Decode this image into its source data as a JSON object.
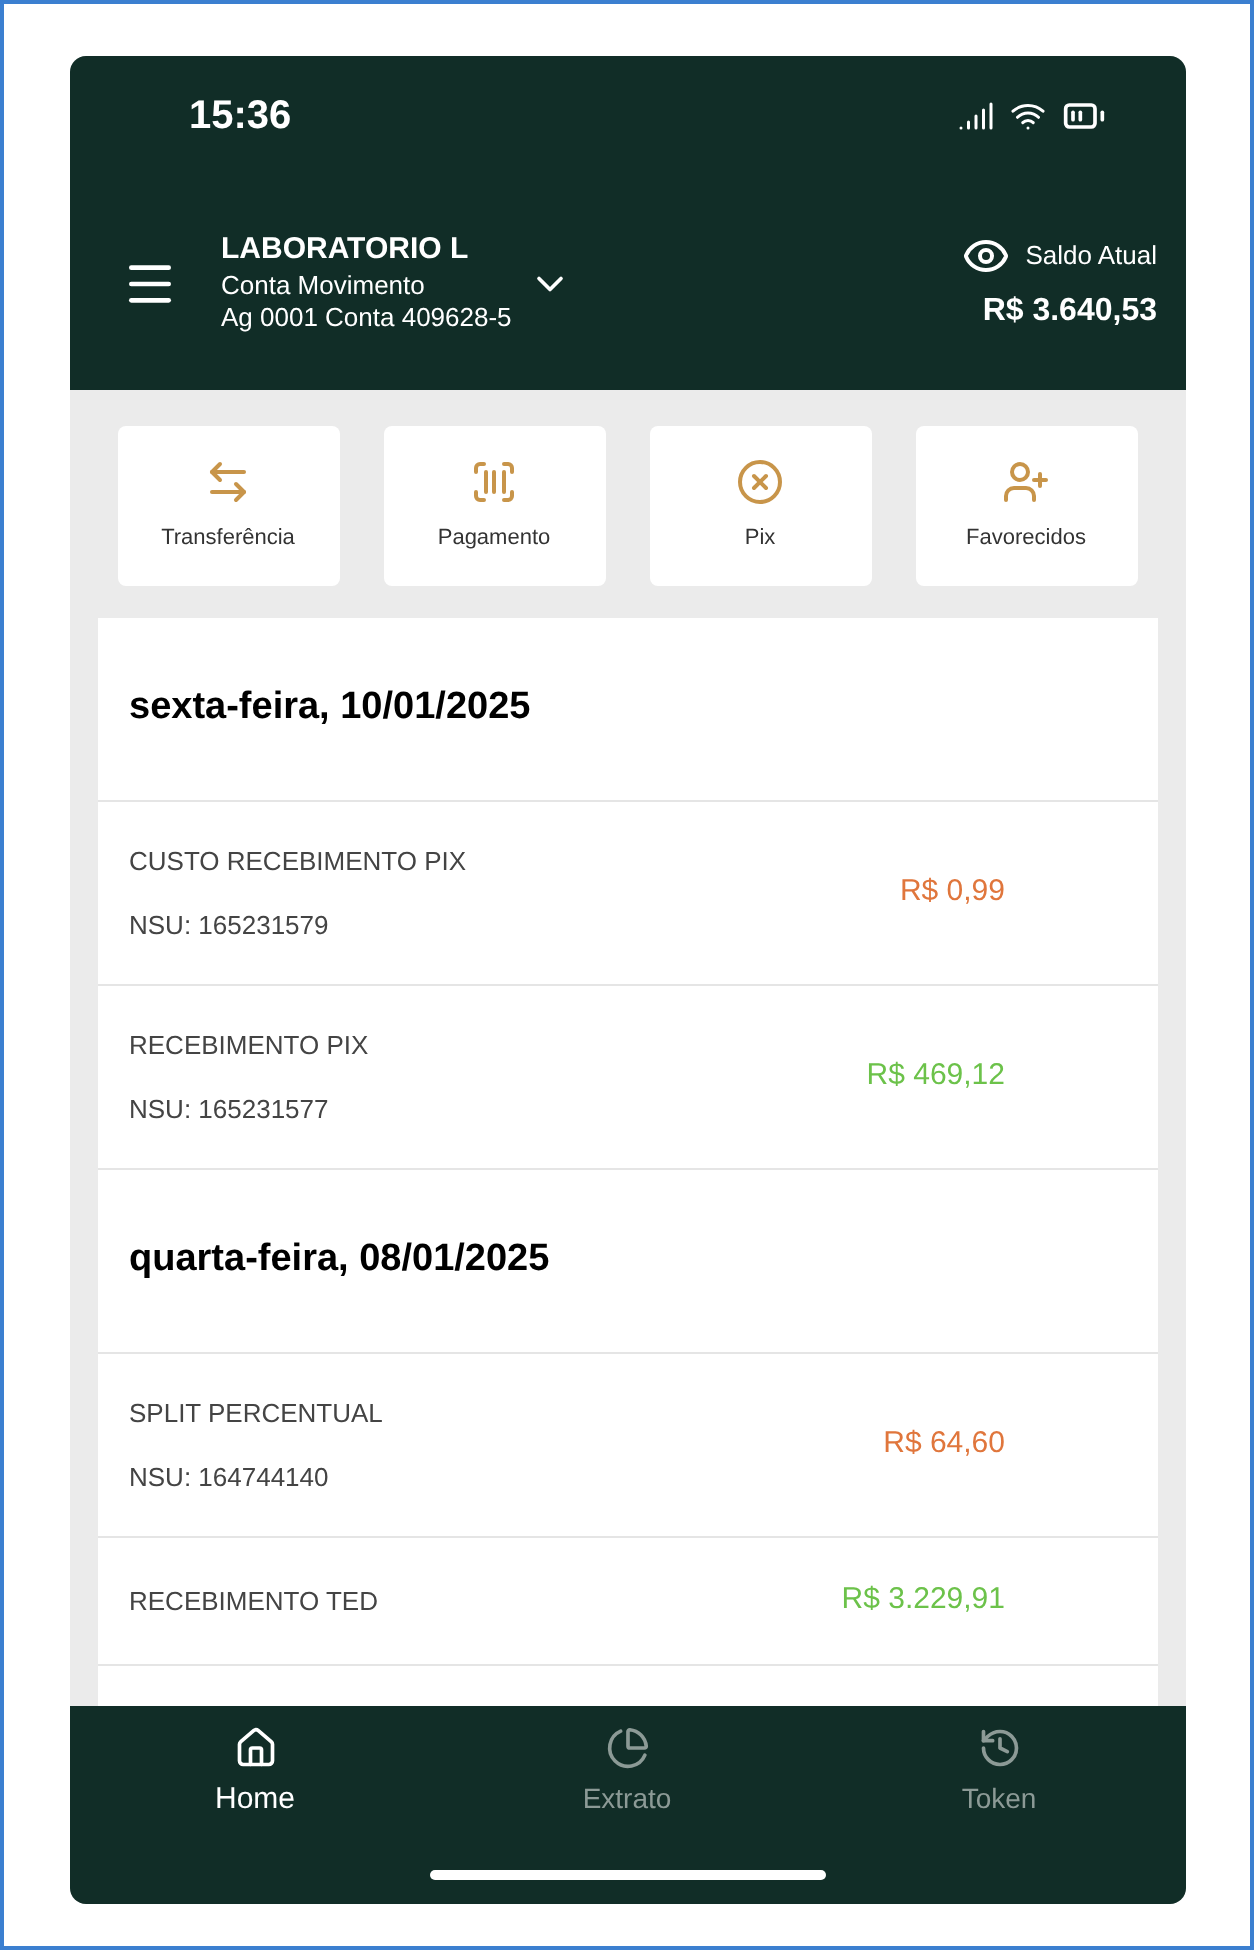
{
  "status_bar": {
    "time": "15:36"
  },
  "account": {
    "name": "LABORATORIO L",
    "type": "Conta Movimento",
    "number": "Ag 0001 Conta 409628-5",
    "balance_label": "Saldo Atual",
    "balance": "R$ 3.640,53"
  },
  "shortcuts": [
    {
      "kind": "transfer",
      "label": "Transferência"
    },
    {
      "kind": "payment",
      "label": "Pagamento"
    },
    {
      "kind": "pix",
      "label": "Pix"
    },
    {
      "kind": "payees",
      "label": "Favorecidos"
    }
  ],
  "days": [
    {
      "date": "sexta-feira, 10/01/2025",
      "transactions": [
        {
          "title": "CUSTO RECEBIMENTO PIX",
          "nsu": "NSU: 165231579",
          "amount": "R$ 0,99",
          "kind": "debit"
        },
        {
          "title": "RECEBIMENTO PIX",
          "nsu": "NSU: 165231577",
          "amount": "R$ 469,12",
          "kind": "credit"
        }
      ]
    },
    {
      "date": "quarta-feira, 08/01/2025",
      "transactions": [
        {
          "title": "SPLIT PERCENTUAL",
          "nsu": "NSU: 164744140",
          "amount": "R$ 64,60",
          "kind": "debit"
        },
        {
          "title": "RECEBIMENTO TED",
          "amount": "R$ 3.229,91",
          "kind": "credit"
        }
      ]
    }
  ],
  "nav": [
    {
      "kind": "home",
      "label": "Home",
      "selected": true
    },
    {
      "kind": "statement",
      "label": "Extrato",
      "selected": false
    },
    {
      "kind": "token",
      "label": "Token",
      "selected": false
    }
  ]
}
